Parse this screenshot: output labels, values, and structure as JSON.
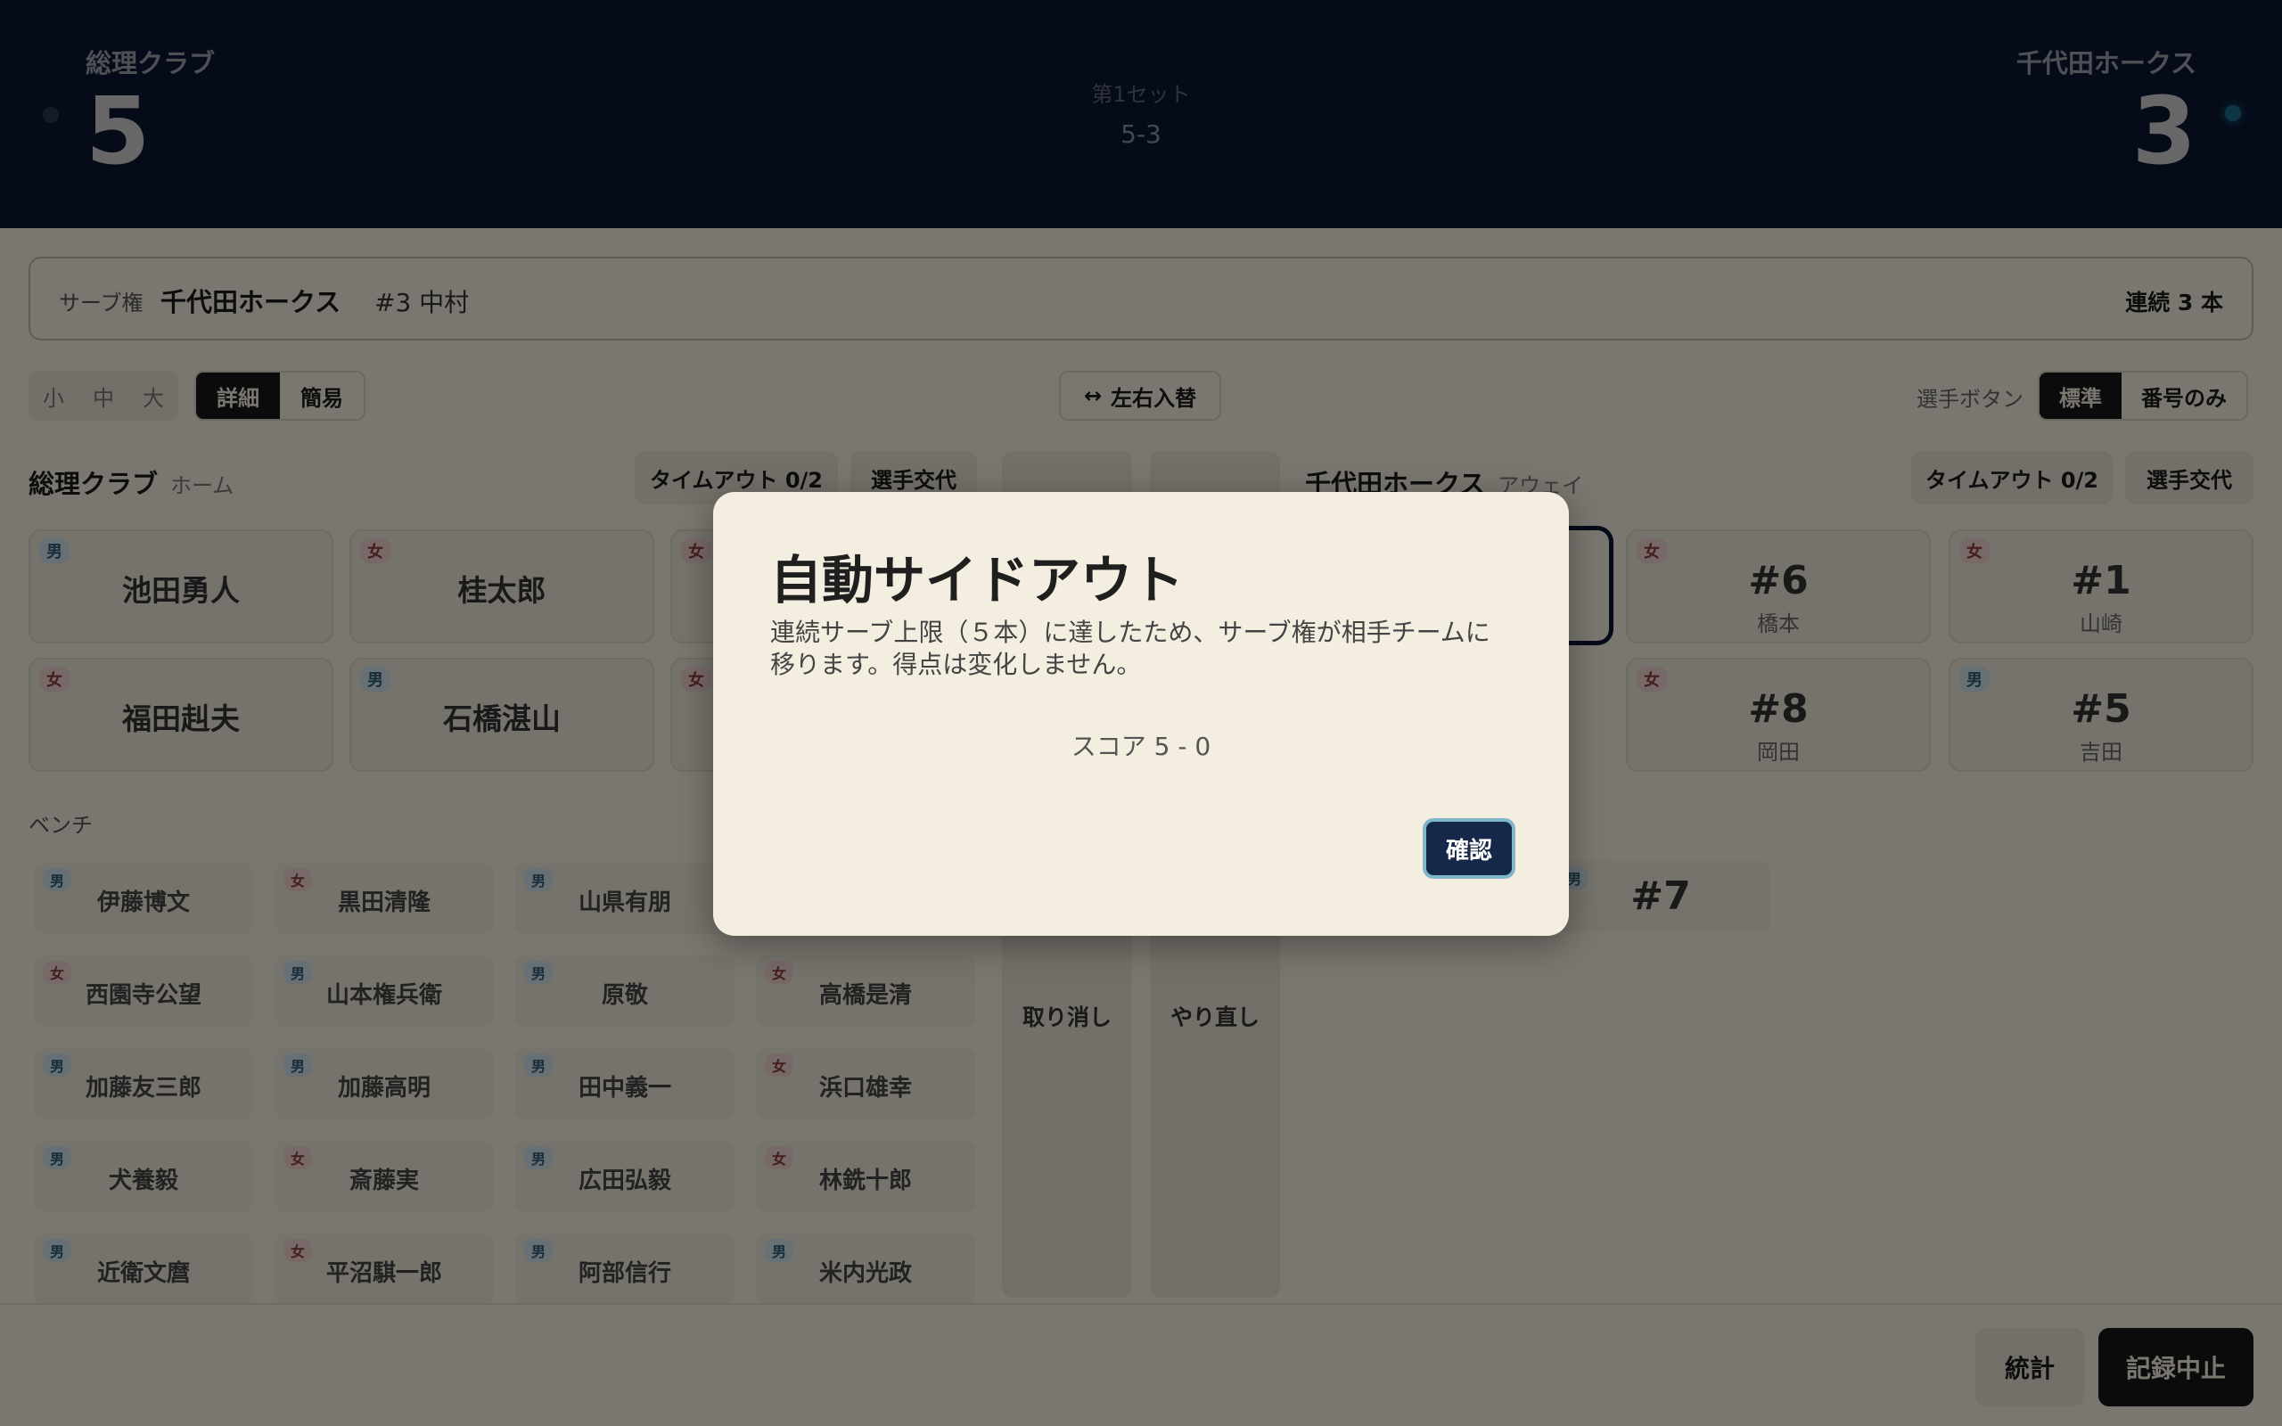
{
  "header": {
    "home": {
      "name": "総理クラブ",
      "score": "5"
    },
    "away": {
      "name": "千代田ホークス",
      "score": "3"
    },
    "set_label": "第1セット",
    "set_score": "5-3"
  },
  "serve_bar": {
    "label": "サーブ権",
    "team": "千代田ホークス",
    "player": "#3 中村",
    "streak": "連続 3 本"
  },
  "toolbar": {
    "sizes": [
      "小",
      "中",
      "大"
    ],
    "detail": "詳細",
    "simple": "簡易",
    "swap": "左右入替",
    "player_button_label": "選手ボタン",
    "standard": "標準",
    "number_only": "番号のみ"
  },
  "home_team": {
    "name": "総理クラブ",
    "role": "ホーム",
    "timeout": "タイムアウト 0/2",
    "substitution": "選手交代",
    "court": [
      {
        "gender": "男",
        "name": "池田勇人"
      },
      {
        "gender": "女",
        "name": "桂太郎"
      },
      {
        "gender": "女",
        "name": "福田赳夫"
      },
      {
        "gender": "男",
        "name": "石橋湛山"
      }
    ],
    "hidden_tags": [
      "女",
      "女"
    ],
    "bench_label": "ベンチ",
    "bench": [
      {
        "gender": "男",
        "name": "伊藤博文"
      },
      {
        "gender": "女",
        "name": "黒田清隆"
      },
      {
        "gender": "男",
        "name": "山県有朋"
      },
      {
        "gender": "女",
        "name": "西園寺公望"
      },
      {
        "gender": "男",
        "name": "山本権兵衛"
      },
      {
        "gender": "男",
        "name": "原敬"
      },
      {
        "gender": "女",
        "name": "高橋是清"
      },
      {
        "gender": "男",
        "name": "加藤友三郎"
      },
      {
        "gender": "男",
        "name": "加藤高明"
      },
      {
        "gender": "男",
        "name": "田中義一"
      },
      {
        "gender": "女",
        "name": "浜口雄幸"
      },
      {
        "gender": "男",
        "name": "犬養毅"
      },
      {
        "gender": "女",
        "name": "斎藤実"
      },
      {
        "gender": "男",
        "name": "広田弘毅"
      },
      {
        "gender": "女",
        "name": "林銑十郎"
      },
      {
        "gender": "男",
        "name": "近衛文麿"
      },
      {
        "gender": "女",
        "name": "平沼騏一郎"
      },
      {
        "gender": "男",
        "name": "阿部信行"
      },
      {
        "gender": "男",
        "name": "米内光政"
      }
    ]
  },
  "center_actions": {
    "undo": "取り消し",
    "redo": "やり直し"
  },
  "away_team": {
    "name": "千代田ホークス",
    "role": "アウェイ",
    "timeout": "タイムアウト 0/2",
    "substitution": "選手交代",
    "court": [
      {
        "gender": "女",
        "number": "#6",
        "name": "橋本"
      },
      {
        "gender": "女",
        "number": "#1",
        "name": "山崎"
      },
      {
        "gender": "女",
        "number": "#8",
        "name": "岡田"
      },
      {
        "gender": "男",
        "number": "#5",
        "name": "吉田"
      }
    ],
    "bench": [
      {
        "gender": "男",
        "number": "#7"
      }
    ]
  },
  "footer": {
    "stats": "統計",
    "stop": "記録中止"
  },
  "modal": {
    "title": "自動サイドアウト",
    "body": "連続サーブ上限（５本）に達したため、サーブ権が相手チームに移ります。得点は変化しません。",
    "score": "スコア 5 - 0",
    "confirm": "確認"
  }
}
